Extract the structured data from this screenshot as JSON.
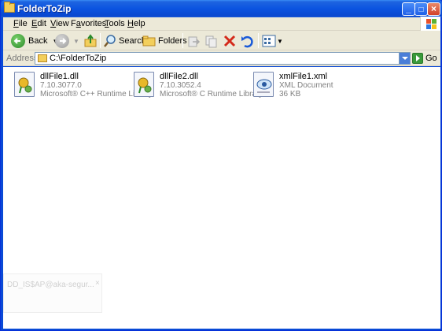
{
  "window": {
    "title": "FolderToZip",
    "min": "_",
    "max": "□",
    "close": "×"
  },
  "menu": {
    "items": [
      {
        "label": "File",
        "key": "F",
        "rest": "ile"
      },
      {
        "label": "Edit",
        "key": "E",
        "rest": "dit"
      },
      {
        "label": "View",
        "key": "V",
        "rest": "iew"
      },
      {
        "label": "Favorites",
        "key": "a",
        "pre": "F",
        "rest": "vorites"
      },
      {
        "label": "Tools",
        "key": "T",
        "rest": "ools"
      },
      {
        "label": "Help",
        "key": "H",
        "rest": "elp"
      }
    ]
  },
  "toolbar": {
    "back_label": "Back",
    "search_label": "Search",
    "folders_label": "Folders"
  },
  "address": {
    "label": "Address",
    "path": "C:\\FolderToZip",
    "go_label": "Go"
  },
  "files": [
    {
      "name": "dllFile1.dll",
      "line1": "7.10.3077.0",
      "line2": "Microsoft® C++ Runtime Library",
      "icon": "dll-icon"
    },
    {
      "name": "dllFile2.dll",
      "line1": "7.10.3052.4",
      "line2": "Microsoft® C Runtime Library",
      "icon": "dll-icon"
    },
    {
      "name": "xmlFile1.xml",
      "line1": "XML Document",
      "line2": "36 KB",
      "icon": "xml-icon"
    }
  ],
  "ghost": {
    "text": "DD_IS$AP@aka-segur...",
    "close": "×"
  },
  "colors": {
    "titlebar": "#0b54e0",
    "chrome": "#ece9d8",
    "close": "#d2412a"
  }
}
